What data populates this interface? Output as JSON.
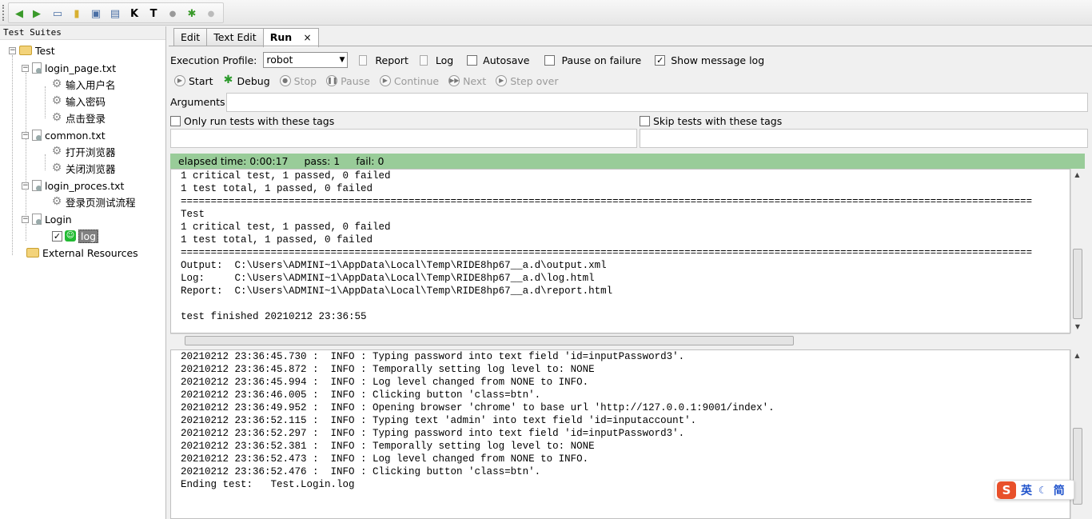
{
  "tree": {
    "header": "Test Suites",
    "items": [
      {
        "label": "Test",
        "icon": "folder-icon"
      },
      {
        "label": "login_page.txt",
        "icon": "file-icon"
      },
      {
        "label": "输入用户名",
        "icon": "gear-icon"
      },
      {
        "label": "输入密码",
        "icon": "gear-icon"
      },
      {
        "label": "点击登录",
        "icon": "gear-icon"
      },
      {
        "label": "common.txt",
        "icon": "file-icon"
      },
      {
        "label": "打开浏览器",
        "icon": "gear-icon"
      },
      {
        "label": "关闭浏览器",
        "icon": "gear-icon"
      },
      {
        "label": "login_proces.txt",
        "icon": "file-icon"
      },
      {
        "label": "登录页测试流程",
        "icon": "gear-icon"
      },
      {
        "label": "Login",
        "icon": "file-icon"
      },
      {
        "label": "log",
        "icon": "robot-icon"
      },
      {
        "label": "External Resources",
        "icon": "folder-icon"
      }
    ]
  },
  "tabs": [
    {
      "label": "Edit"
    },
    {
      "label": "Text Edit"
    },
    {
      "label": "Run",
      "close": "×"
    }
  ],
  "run": {
    "profile_label": "Execution Profile:",
    "profile_value": "robot",
    "report": "Report",
    "log": "Log",
    "autosave": "Autosave",
    "pause_on_failure": "Pause on failure",
    "show_message_log": "Show message log",
    "buttons": {
      "start": "Start",
      "debug": "Debug",
      "stop": "Stop",
      "pause": "Pause",
      "continue": "Continue",
      "next": "Next",
      "step_over": "Step over"
    },
    "arguments_label": "Arguments:",
    "only_run_tags": "Only run tests with these tags",
    "skip_tags": "Skip tests with these tags"
  },
  "status": {
    "elapsed": "elapsed time: 0:00:17",
    "pass": "pass: 1",
    "fail": "fail: 0",
    "color": "#99cc99"
  },
  "output_lines": [
    "1 critical test, 1 passed, 0 failed",
    "1 test total, 1 passed, 0 failed",
    "==============================================================================================================================================",
    "Test",
    "1 critical test, 1 passed, 0 failed",
    "1 test total, 1 passed, 0 failed",
    "==============================================================================================================================================",
    "Output:  C:\\Users\\ADMINI~1\\AppData\\Local\\Temp\\RIDE8hp67__a.d\\output.xml",
    "Log:     C:\\Users\\ADMINI~1\\AppData\\Local\\Temp\\RIDE8hp67__a.d\\log.html",
    "Report:  C:\\Users\\ADMINI~1\\AppData\\Local\\Temp\\RIDE8hp67__a.d\\report.html",
    "",
    "test finished 20210212 23:36:55"
  ],
  "log_lines": [
    "20210212 23:36:45.730 :  INFO : Typing password into text field 'id=inputPassword3'.",
    "20210212 23:36:45.872 :  INFO : Temporally setting log level to: NONE",
    "20210212 23:36:45.994 :  INFO : Log level changed from NONE to INFO.",
    "20210212 23:36:46.005 :  INFO : Clicking button 'class=btn'.",
    "20210212 23:36:49.952 :  INFO : Opening browser 'chrome' to base url 'http://127.0.0.1:9001/index'.",
    "20210212 23:36:52.115 :  INFO : Typing text 'admin' into text field 'id=inputaccount'.",
    "20210212 23:36:52.297 :  INFO : Typing password into text field 'id=inputPassword3'.",
    "20210212 23:36:52.381 :  INFO : Temporally setting log level to: NONE",
    "20210212 23:36:52.473 :  INFO : Log level changed from NONE to INFO.",
    "20210212 23:36:52.476 :  INFO : Clicking button 'class=btn'.",
    "Ending test:   Test.Login.log"
  ],
  "ime": {
    "logo": "S",
    "lang": "英",
    "mode": "简"
  }
}
